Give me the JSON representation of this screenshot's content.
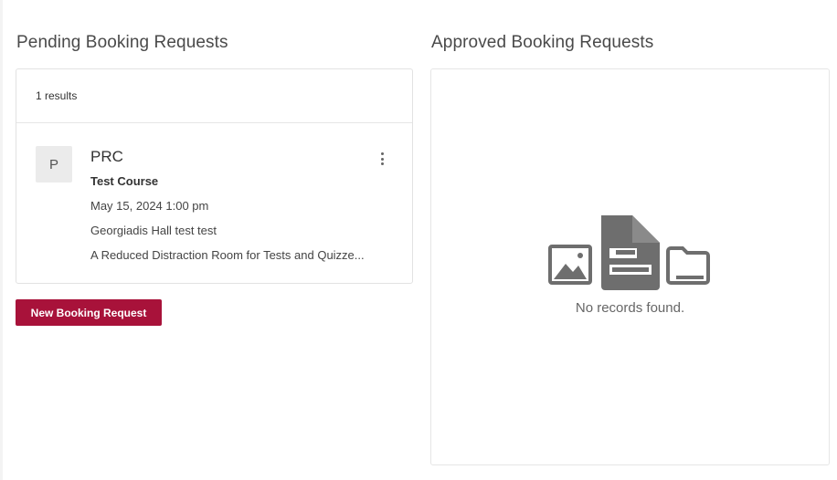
{
  "pending": {
    "title": "Pending Booking Requests",
    "results_count": "1 results",
    "items": [
      {
        "avatar_letter": "P",
        "title": "PRC",
        "course": "Test Course",
        "datetime": "May 15, 2024 1:00 pm",
        "location": "Georgiadis Hall test test",
        "description": "A Reduced Distraction Room for Tests and Quizze..."
      }
    ],
    "more_icon": "more-vertical-icon"
  },
  "actions": {
    "new_booking_label": "New Booking Request"
  },
  "approved": {
    "title": "Approved Booking Requests",
    "empty_text": "No records found.",
    "empty_icons": [
      "image-icon",
      "document-icon",
      "folder-icon"
    ]
  },
  "colors": {
    "accent": "#a8123a",
    "icon_gray": "#6e6e6e"
  }
}
